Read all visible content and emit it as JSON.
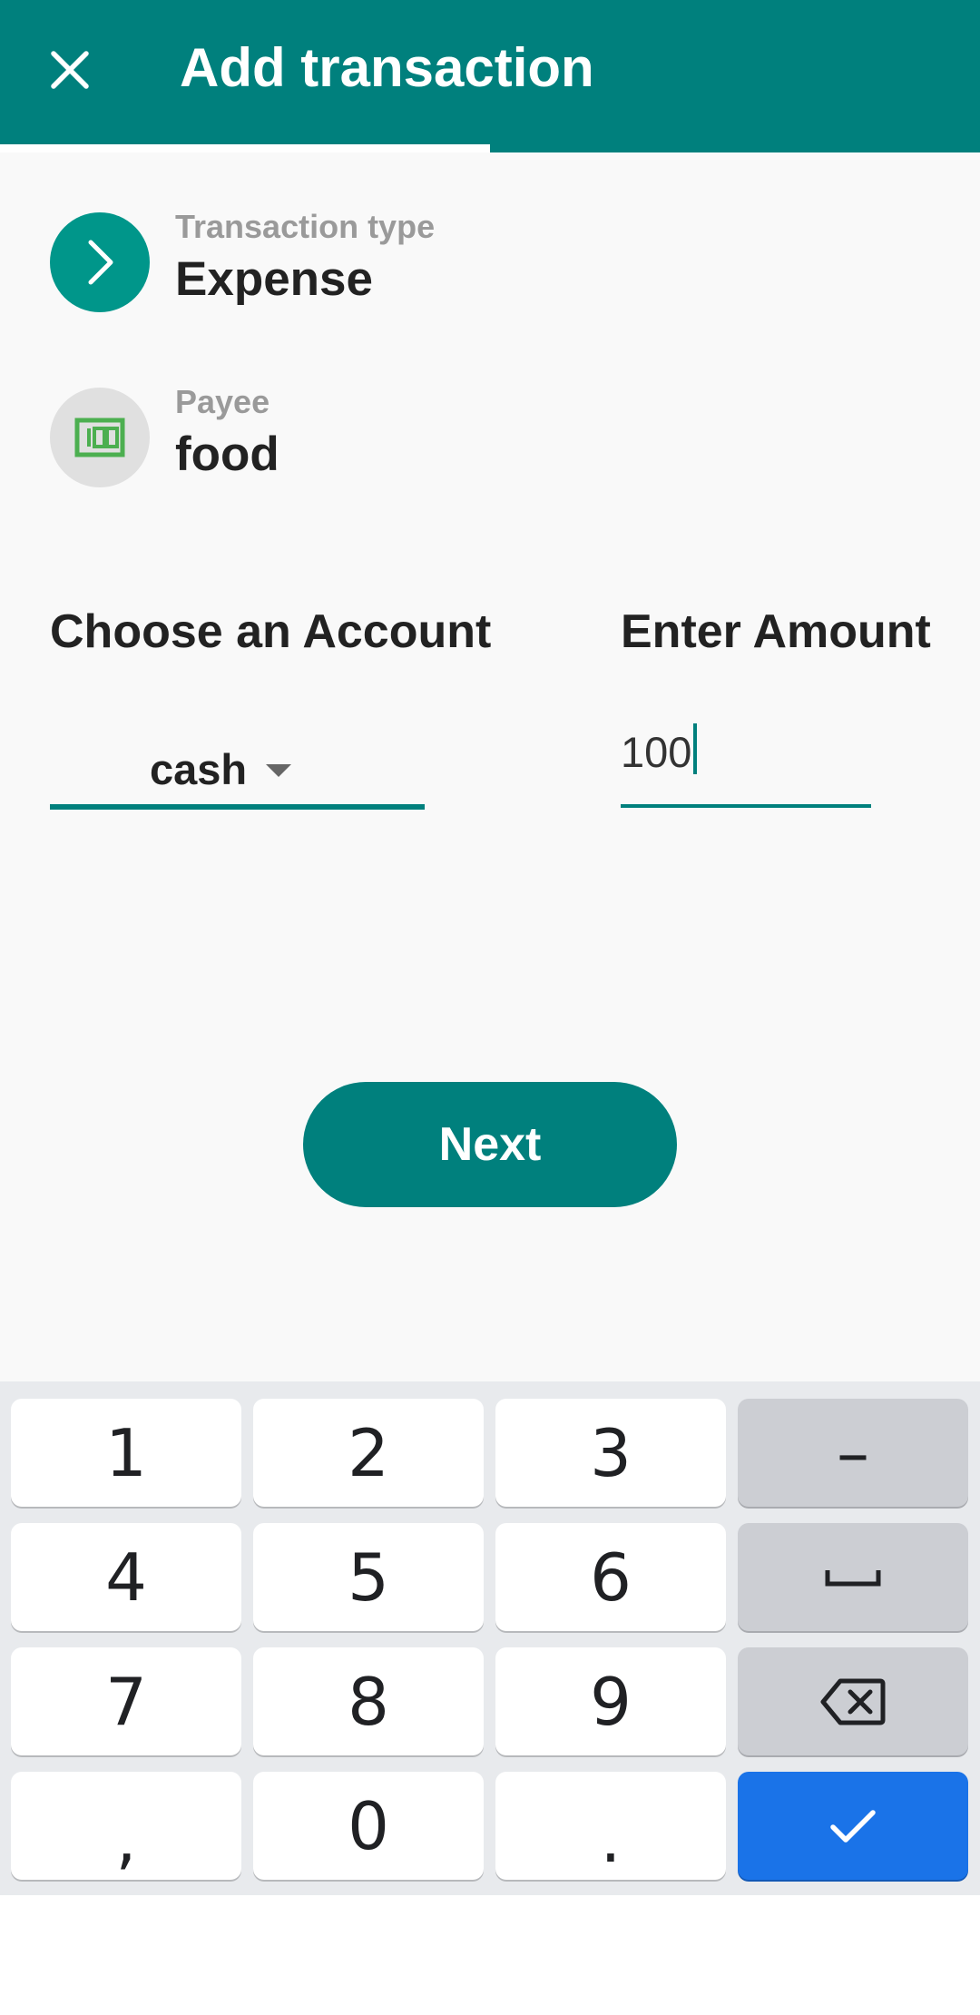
{
  "colors": {
    "primary": "#00807d",
    "icon_teal": "#00968a",
    "payee_icon_bg": "#e0e0e0",
    "payee_icon_green": "#4caf50",
    "background": "#f9f9f9",
    "keyboard_bg": "#e8eaed",
    "done_key": "#1a73e8"
  },
  "header": {
    "title": "Add transaction",
    "close_icon": "close-icon",
    "progress_fraction": 0.5
  },
  "transaction_type": {
    "label": "Transaction type",
    "value": "Expense",
    "icon": "chevron-right-icon"
  },
  "payee": {
    "label": "Payee",
    "value": "food",
    "icon": "cash-icon"
  },
  "account": {
    "label": "Choose an Account",
    "value": "cash",
    "icon": "dropdown-arrow-icon"
  },
  "amount": {
    "label": "Enter Amount",
    "value": "100"
  },
  "next_button": {
    "label": "Next"
  },
  "keyboard": {
    "keys": {
      "k1": "1",
      "k2": "2",
      "k3": "3",
      "k4": "4",
      "k5": "5",
      "k6": "6",
      "k7": "7",
      "k8": "8",
      "k9": "9",
      "comma": ",",
      "k0": "0",
      "period": ".",
      "minus": "–"
    },
    "icons": {
      "space": "space-icon",
      "backspace": "backspace-icon",
      "done": "checkmark-icon"
    }
  }
}
